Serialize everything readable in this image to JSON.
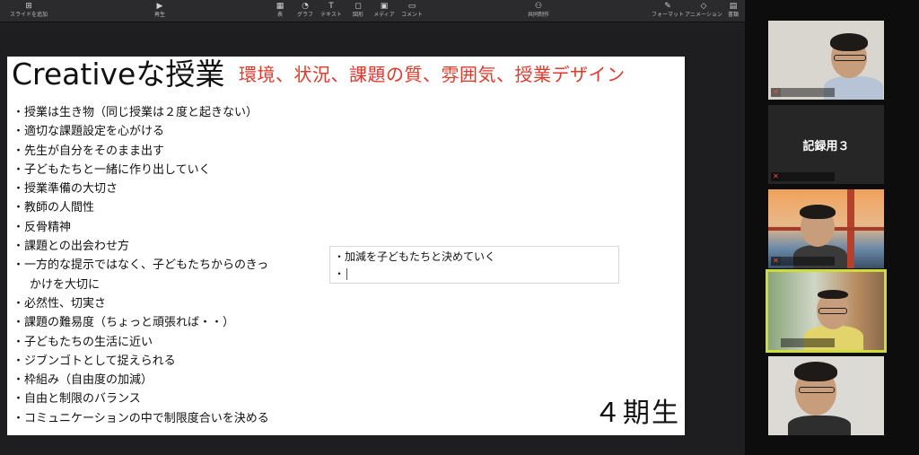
{
  "toolbar": {
    "items": [
      {
        "label": "スライドを追加",
        "icon": "add-slide-icon"
      },
      {
        "label": "再生",
        "icon": "play-icon"
      },
      {
        "label": "表",
        "icon": "table-icon"
      },
      {
        "label": "グラフ",
        "icon": "chart-icon"
      },
      {
        "label": "テキスト",
        "icon": "text-icon"
      },
      {
        "label": "図形",
        "icon": "shape-icon"
      },
      {
        "label": "メディア",
        "icon": "media-icon"
      },
      {
        "label": "コメント",
        "icon": "comment-icon"
      },
      {
        "label": "共同制作",
        "icon": "collaborate-icon"
      },
      {
        "label": "フォーマット",
        "icon": "format-icon"
      },
      {
        "label": "アニメーション",
        "icon": "animation-icon"
      },
      {
        "label": "書類",
        "icon": "document-icon"
      }
    ]
  },
  "slide": {
    "title": "Creativeな授業",
    "subtitle": "環境、状況、課題の質、雰囲気、授業デザイン",
    "bullets": [
      "・授業は生き物（同じ授業は２度と起きない）",
      "・適切な課題設定を心がける",
      "・先生が自分をそのまま出す",
      "・子どもたちと一緒に作り出していく",
      "・授業準備の大切さ",
      "・教師の人間性",
      "・反骨精神",
      "・課題との出会わせ方",
      "・一方的な提示ではなく、子どもたちからのきっ",
      "かけを大切に",
      "・必然性、切実さ",
      "・課題の難易度（ちょっと頑張れば・・）",
      "・子どもたちの生活に近い",
      "・ジブンゴトとして捉えられる",
      "・枠組み（自由度の加減）",
      "・自由と制限のバランス",
      "・コミュニケーションの中で制限度合いを決める"
    ],
    "textbox": {
      "line1": "・加減を子どもたちと決めていく",
      "line2": "・"
    },
    "cohort": "４期生"
  },
  "participants": {
    "tile2_label": "記録用３",
    "accent": "#cddc39",
    "muted_icon": "muted-mic-icon"
  },
  "colors": {
    "subtitle": "#e0392b",
    "active_speaker": "#cddc39"
  }
}
